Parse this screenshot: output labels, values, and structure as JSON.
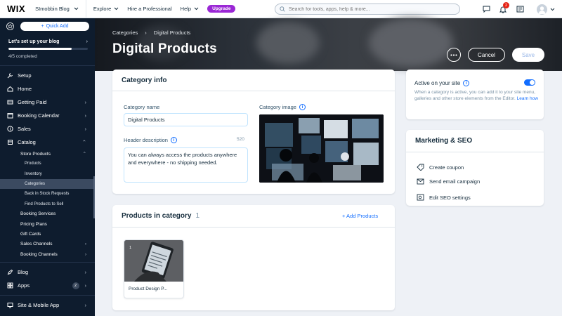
{
  "topbar": {
    "logo": "WIX",
    "site_name": "SImobbin Blog",
    "nav": [
      "Explore",
      "Hire a Professional",
      "Help"
    ],
    "upgrade_label": "Upgrade",
    "search_placeholder": "Search for tools, apps, help & more...",
    "notification_count": "2",
    "icons": [
      "chat-icon",
      "bell-icon",
      "news-icon",
      "avatar"
    ]
  },
  "sidebar": {
    "quick_add": "Quick Add",
    "setup_title": "Let's set up your blog",
    "setup_progress": "4/5 completed",
    "setup_progress_value": 0.8,
    "items": [
      {
        "label": "Setup"
      },
      {
        "label": "Home"
      },
      {
        "label": "Getting Paid"
      },
      {
        "label": "Booking Calendar"
      },
      {
        "label": "Sales"
      },
      {
        "label": "Catalog"
      }
    ],
    "store_products": "Store Products",
    "store_sub": [
      "Products",
      "Inventory",
      "Categories",
      "Back in Stock Requests",
      "Find Products to Sell"
    ],
    "catalog_sub": [
      "Booking Services",
      "Pricing Plans",
      "Gift Cards",
      "Sales Channels",
      "Booking Channels"
    ],
    "bottom_items": [
      {
        "label": "Blog"
      },
      {
        "label": "Apps",
        "count": "2"
      }
    ],
    "site_mobile": "Site & Mobile App"
  },
  "header": {
    "breadcrumb": [
      "Categories",
      "Digital Products"
    ],
    "title": "Digital Products",
    "cancel_label": "Cancel",
    "save_label": "Save"
  },
  "category_info": {
    "title": "Category info",
    "name_label": "Category name",
    "name_value": "Digital Products",
    "desc_label": "Header description",
    "desc_count": "520",
    "desc_value": "You can always access the products anywhere and everywhere - no shipping needed.",
    "image_label": "Category image"
  },
  "active_panel": {
    "title": "Active on your site",
    "description": "When a category is active, you can add it to your site menu, galleries and other store elements from the Editor.",
    "learn_more": "Learn how",
    "active": true
  },
  "marketing": {
    "title": "Marketing & SEO",
    "items": [
      {
        "label": "Create coupon",
        "icon": "coupon-icon"
      },
      {
        "label": "Send email campaign",
        "icon": "mail-icon"
      },
      {
        "label": "Edit SEO settings",
        "icon": "seo-icon"
      }
    ]
  },
  "products": {
    "title": "Products in category",
    "count": "1",
    "add_label": "+ Add Products",
    "items": [
      {
        "name": "Product Design P..."
      }
    ]
  },
  "colors": {
    "accent": "#116dff",
    "sidebar_bg": "#0e1c2e",
    "upgrade": "#9a27d5"
  }
}
